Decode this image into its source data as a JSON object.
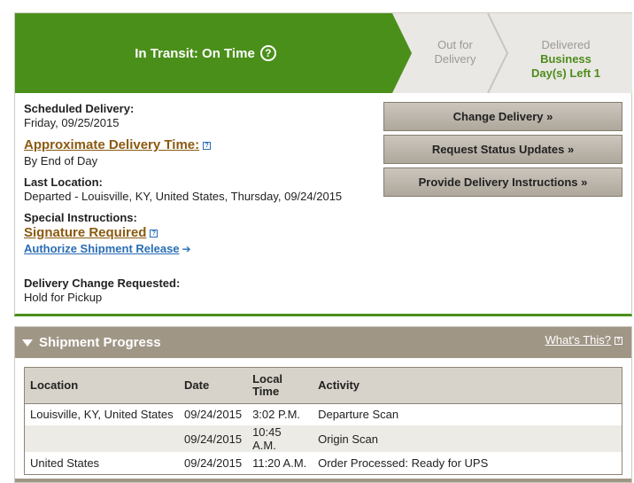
{
  "progress": {
    "current_stage": "In Transit: On Time",
    "help_symbol": "?",
    "out_for_delivery": [
      "Out for",
      "Delivery"
    ],
    "delivered_label": "Delivered",
    "delivered_detail": [
      "Business",
      "Day(s) Left 1"
    ],
    "colors": {
      "active": "#4a8f1a",
      "inactive": "#e9e8e4"
    }
  },
  "details": {
    "scheduled_label": "Scheduled Delivery:",
    "scheduled_value": "Friday, 09/25/2015",
    "approx_label": "Approximate Delivery Time:",
    "approx_value": "By End of Day",
    "last_location_label": "Last Location:",
    "last_location_value": "Departed - Louisville, KY, United States, Thursday, 09/24/2015",
    "special_label": "Special Instructions:",
    "signature_link": "Signature Required",
    "authorize_link": "Authorize Shipment Release",
    "change_requested_label": "Delivery Change Requested:",
    "change_requested_value": "Hold for Pickup"
  },
  "actions": {
    "change_delivery": "Change Delivery »",
    "request_updates": "Request Status Updates »",
    "provide_instructions": "Provide Delivery Instructions »"
  },
  "shipment_progress": {
    "title": "Shipment Progress",
    "whats_this": "What's This?",
    "columns": [
      "Location",
      "Date",
      "Local Time",
      "Activity"
    ],
    "column_lines": {
      "local_time": [
        "Local",
        "Time"
      ]
    },
    "rows": [
      {
        "location": "Louisville, KY, United States",
        "date": "09/24/2015",
        "time": "3:02 P.M.",
        "activity": "Departure Scan"
      },
      {
        "location": "",
        "date": "09/24/2015",
        "time": "10:45 A.M.",
        "activity": "Origin Scan"
      },
      {
        "location": "United States",
        "date": "09/24/2015",
        "time": "11:20 A.M.",
        "activity": "Order Processed: Ready for UPS"
      }
    ]
  }
}
